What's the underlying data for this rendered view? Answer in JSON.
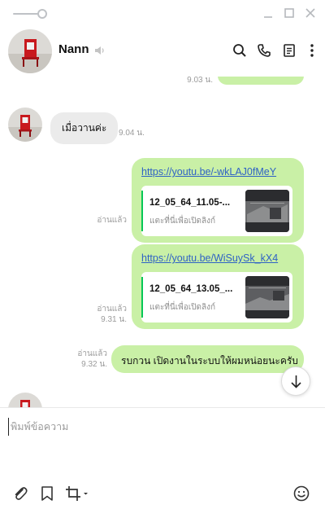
{
  "window": {
    "controls": [
      "minimize",
      "maximize",
      "close"
    ]
  },
  "header": {
    "contact_name": "Nann",
    "icons": [
      "speaker-icon",
      "search-icon",
      "phone-icon",
      "notes-icon",
      "more-icon"
    ]
  },
  "messages": {
    "prev_time": "9.03 น.",
    "incoming_1": {
      "text": "เมื่อวานค่ะ",
      "time": "9.04 น."
    },
    "outgoing_1": {
      "link": "https://youtu.be/-wkLAJ0fMeY",
      "preview_title": "12_05_64_11.05-...",
      "preview_sub": "แตะที่นี่เพื่อเปิดลิงก์",
      "read": "อ่านแล้ว"
    },
    "outgoing_2": {
      "link": "https://youtu.be/WiSuySk_kX4",
      "preview_title": "12_05_64_13.05_...",
      "preview_sub": "แตะที่นี่เพื่อเปิดลิงก์",
      "read": "อ่านแล้ว",
      "time": "9.31 น."
    },
    "outgoing_3": {
      "text": "รบกวน เปิดงานในระบบให้ผมหน่อยนะครับ",
      "read": "อ่านแล้ว",
      "time": "9.32 น."
    }
  },
  "input": {
    "placeholder": "พิมพ์ข้อความ",
    "value": ""
  },
  "colors": {
    "outgoing_bubble": "#c9f0a6",
    "incoming_bubble": "#ebebeb",
    "link": "#2f62c5",
    "preview_accent": "#06c755"
  }
}
